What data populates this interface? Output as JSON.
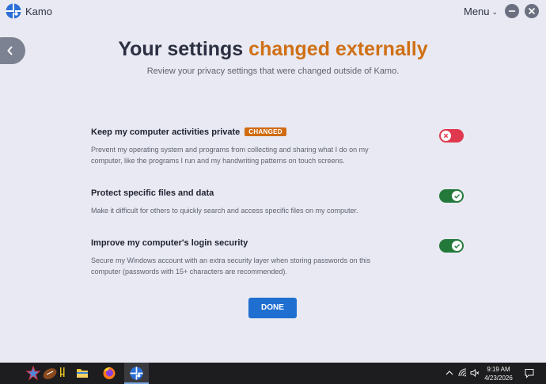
{
  "app": {
    "name": "Kamo",
    "menu_label": "Menu"
  },
  "header": {
    "title_part1": "Your settings ",
    "title_part2": "changed externally",
    "subtitle": "Review your privacy settings that were changed outside of Kamo."
  },
  "settings": [
    {
      "title": "Keep my computer activities private",
      "badge": "CHANGED",
      "description": "Prevent my operating system and programs from collecting and sharing what I do on my computer, like the programs I run and my handwriting patterns on touch screens.",
      "enabled": false
    },
    {
      "title": "Protect specific files and data",
      "badge": "",
      "description": "Make it difficult for others to quickly search and access specific files on my computer.",
      "enabled": true
    },
    {
      "title": "Improve my computer's login security",
      "badge": "",
      "description": "Secure my Windows account with an extra security layer when storing passwords on this computer (passwords with 15+ characters are recommended).",
      "enabled": true
    }
  ],
  "done_label": "DONE",
  "taskbar": {
    "time": "9:19 AM",
    "date": "4/23/2026",
    "pinned": [
      "games-icon",
      "file-explorer-icon",
      "firefox-icon",
      "kamo-icon"
    ]
  },
  "colors": {
    "accent": "#d07016",
    "toggle_on": "#23793a",
    "toggle_off": "#e0394f",
    "primary_button": "#1f6fd0",
    "badge": "#d06c12"
  }
}
